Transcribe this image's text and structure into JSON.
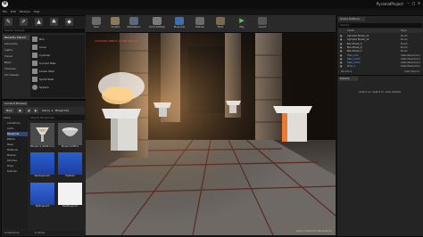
{
  "window": {
    "project_name": "PyramidProject",
    "min": "–",
    "max": "□",
    "close": "✕"
  },
  "menu": [
    "File",
    "Edit",
    "Window",
    "Help"
  ],
  "modes": {
    "tab_icons": [
      "place-icon",
      "paint-icon",
      "landscape-icon",
      "foliage-icon",
      "geometry-edit-icon"
    ],
    "search_placeholder": "Search Classes",
    "categories": [
      "Recently Placed",
      "Geometry",
      "Lights",
      "Visual",
      "Basic",
      "Volumes",
      "All Classes"
    ],
    "items": [
      "Box",
      "Cone",
      "Cylinder",
      "Curved Stair",
      "Linear Stair",
      "Spiral Stair",
      "Sphere"
    ]
  },
  "toolbar": [
    "Save",
    "Content",
    "Marketplace",
    "Quick Settings",
    "Blueprints",
    "Matinee",
    "Build",
    "Play",
    "Launch"
  ],
  "viewport": {
    "warning": "LIGHTING NEEDS TO BE REBUILT",
    "level": "Level: Pyramid (Persistent)"
  },
  "outliner": {
    "tab": "Scene Outliner",
    "search_placeholder": "Search...",
    "col_label": "Label",
    "col_type": "Type",
    "rows": [
      {
        "name": "Cylinder Brush_11",
        "type": "Brush"
      },
      {
        "name": "Cylinder Brush_12",
        "type": "Brush"
      },
      {
        "name": "Box Brush_5",
        "type": "Brush"
      },
      {
        "name": "Box Brush_6",
        "type": "Brush"
      },
      {
        "name": "Box Brush_7",
        "type": "Brush"
      },
      {
        "name": "Wall_Arch",
        "type": "StaticMeshActor"
      },
      {
        "name": "Wall_Arch2",
        "type": "StaticMeshActor"
      },
      {
        "name": "Wall_Arch3",
        "type": "StaticMeshActor"
      },
      {
        "name": "Pillar_1",
        "type": "StaticMeshActor"
      },
      {
        "name": "Pillar_2",
        "type": "StaticMeshActor"
      },
      {
        "name": "Pillar_3",
        "type": "StaticMeshActor"
      }
    ],
    "footer": "69 actors",
    "view_options": "View Options"
  },
  "details": {
    "tab": "Details",
    "message": "Select an object to view details."
  },
  "content_browser": {
    "tab": "Content Browser",
    "new_label": "New",
    "save_icon": "save-icon",
    "crumbs": [
      "Game",
      "Blueprints"
    ],
    "filter_placeholder": "Search Blueprints",
    "tree": [
      "Game",
      "Animations",
      "Audio",
      "Blueprints",
      "Effects",
      "Maps",
      "Materials",
      "Meshes",
      "Particles",
      "Props",
      "Textures"
    ],
    "assets": [
      {
        "name": "Blueprint_WallSconce",
        "kind": "sconce"
      },
      {
        "name": "BlueprintOffice",
        "kind": "bowl"
      },
      {
        "name": "NavSeparator",
        "kind": "blue"
      },
      {
        "name": "MyNode",
        "kind": "blue"
      },
      {
        "name": "MyBlueprint",
        "kind": "blue"
      },
      {
        "name": "NewBlueprint",
        "kind": "white"
      }
    ],
    "footer": "6 items",
    "collections_label": "Collections"
  }
}
